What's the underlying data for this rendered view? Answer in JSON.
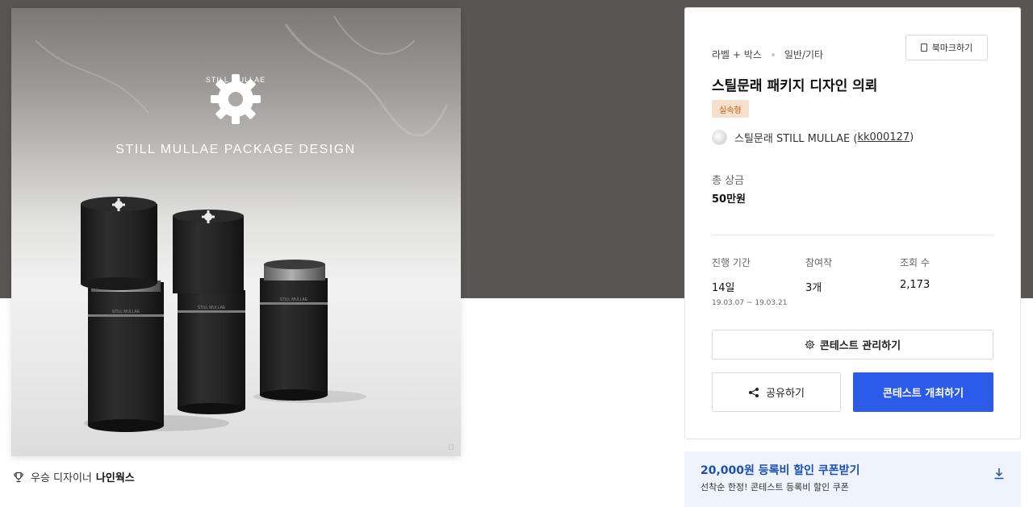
{
  "hero": {
    "brand_text": "STILL MULLAE",
    "headline": "STILL MULLAE PACKAGE DESIGN",
    "tube_label": "STILL MULLAE"
  },
  "winner": {
    "label": "우승 디자이너",
    "name": "나인웍스"
  },
  "panel": {
    "category": "라벨 + 박스",
    "subcategory": "일반/기타",
    "bookmark_label": "북마크하기",
    "title": "스틸문래 패키지 디자인 의뢰",
    "tag": "실속형",
    "host_name": "스틸문래 STILL MULLAE (",
    "host_id": "kk000127",
    "host_close": ")",
    "prize_label": "총 상금",
    "prize_value": "50만원",
    "stats": {
      "period_label": "진행 기간",
      "period_value": "14일",
      "period_dates": "19.03.07 ~ 19.03.21",
      "entries_label": "참여작",
      "entries_value": "3개",
      "views_label": "조회 수",
      "views_value": "2,173"
    },
    "manage_label": "콘테스트 관리하기",
    "share_label": "공유하기",
    "host_contest_label": "콘테스트 개최하기"
  },
  "coupon": {
    "title": "20,000원 등록비 할인 쿠폰받기",
    "subtitle": "선착순 한정! 콘테스트 등록비 할인 쿠폰"
  },
  "colors": {
    "primary": "#2c5ae9",
    "coupon_bg": "#eef3fc",
    "coupon_text": "#1d4eb5",
    "tag_bg": "#f6dfcb",
    "tag_text": "#b5601d",
    "top_band": "#575654"
  },
  "icons": [
    "trophy-icon",
    "bookmark-icon",
    "gear-icon",
    "share-icon",
    "download-icon"
  ]
}
